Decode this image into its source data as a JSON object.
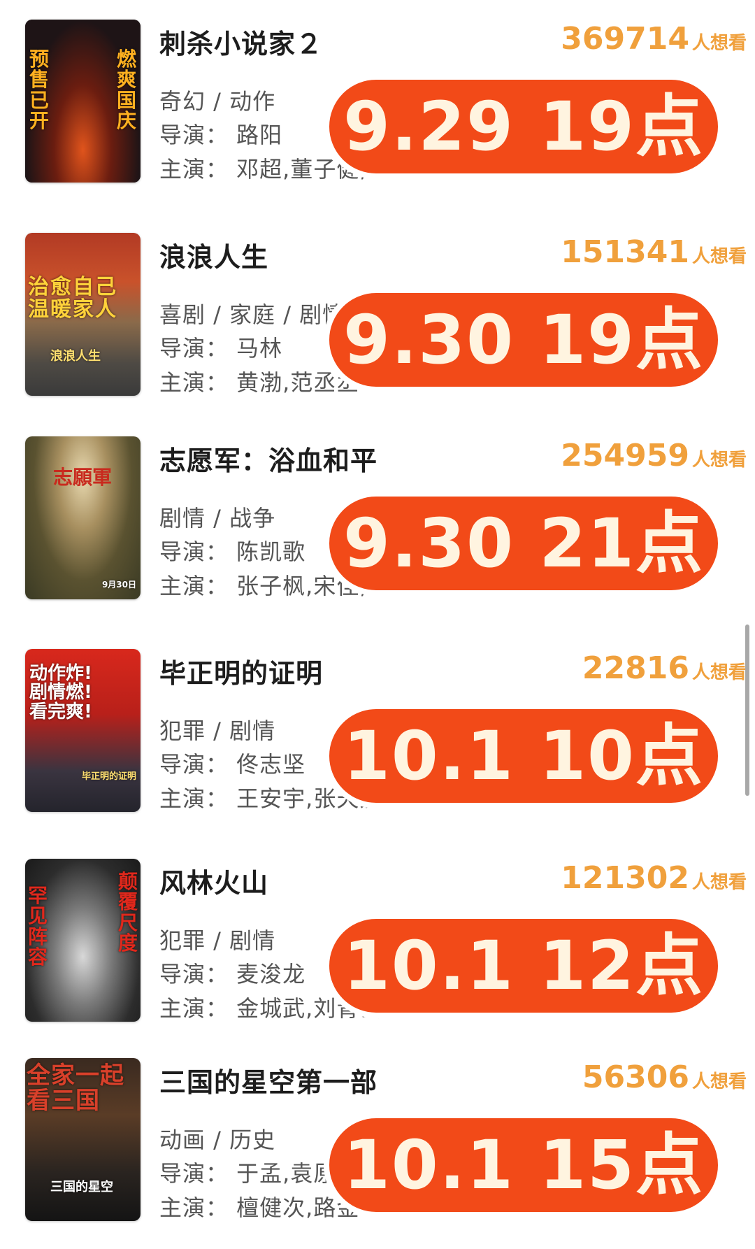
{
  "want_label": "人想看",
  "accent_color": "#f24a18",
  "want_color": "#f0a03c",
  "movies": [
    {
      "title": "刺杀小说家２",
      "want_count": "369714",
      "genre": "奇幻 / 动作",
      "director": "导演：  路阳",
      "cast": "主演：  邓超,董子健,",
      "release": "9.29 19点",
      "poster_text_left": "预\n售\n已\n开",
      "poster_text_right": "燃\n爽\n国\n庆"
    },
    {
      "title": "浪浪人生",
      "want_count": "151341",
      "genre": "喜剧 / 家庭 / 剧情",
      "director": "导演：  马林",
      "cast": "主演：  黄渤,范丞丞",
      "release": "9.30 19点",
      "poster_text_left": "治愈自己\n温暖家人",
      "poster_text_right": "浪浪人生"
    },
    {
      "title": "志愿军：浴血和平",
      "want_count": "254959",
      "genre": "剧情 / 战争",
      "director": "导演：  陈凯歌",
      "cast": "主演：  张子枫,宋佳,",
      "release": "9.30 21点",
      "poster_text_left": "志願軍",
      "poster_text_right": "9月30日"
    },
    {
      "title": "毕正明的证明",
      "want_count": "22816",
      "genre": "犯罪 / 剧情",
      "director": "导演：  佟志坚",
      "cast": "主演：  王安宇,张天爱",
      "release": "10.1 10点",
      "poster_text_left": "动作炸!\n剧情燃!\n看完爽!",
      "poster_text_right": "毕正明的证明"
    },
    {
      "title": "风林火山",
      "want_count": "121302",
      "genre": "犯罪 / 剧情",
      "director": "导演：  麦浚龙",
      "cast": "主演：  金城武,刘青云",
      "release": "10.1 12点",
      "poster_text_left": "罕\n见\n阵\n容",
      "poster_text_right": "颠\n覆\n尺\n度"
    },
    {
      "title": "三国的星空第一部",
      "want_count": "56306",
      "genre": "动画 / 历史",
      "director": "导演：  于孟,袁原",
      "cast": "主演：  檀健次,路金",
      "release": "10.1 15点",
      "poster_text_left": "全家一起\n看三国",
      "poster_text_right": "三国的星空"
    }
  ]
}
